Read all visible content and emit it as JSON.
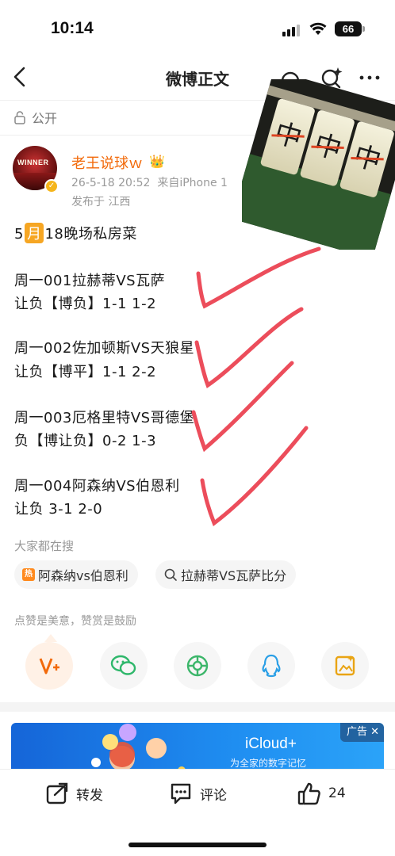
{
  "status": {
    "time": "10:14",
    "battery": "66"
  },
  "nav": {
    "title": "微博正文"
  },
  "post_meta": {
    "visibility": "公开",
    "username": "老王说球ｗ",
    "crown": "👑",
    "timestamp": "26-5-18 20:52",
    "source": "来自iPhone 1",
    "location": "发布于 江西"
  },
  "avatar_text": "WINNER",
  "post": {
    "title_pre": "5",
    "title_month": "月",
    "title_post": "18晚场私房菜",
    "matches": [
      {
        "line1": "周一001拉赫蒂VS瓦萨",
        "line2": "让负【博负】1-1 1-2"
      },
      {
        "line1": "周一002佐加顿斯VS天狼星",
        "line2": "让负【博平】1-1 2-2"
      },
      {
        "line1": "周一003厄格里特VS哥德堡",
        "line2": "负【博让负】0-2 1-3"
      },
      {
        "line1": "周一004阿森纳VS伯恩利",
        "line2": "让负 3-1 2-0"
      }
    ]
  },
  "search": {
    "label": "大家都在搜",
    "chips": [
      "阿森纳vs伯恩利",
      "拉赫蒂VS瓦萨比分"
    ]
  },
  "like_hint": "点赞是美意，赞赏是鼓励",
  "ad": {
    "title": "iCloud+",
    "subtitle": "为全家的数字记忆",
    "tag": "广告"
  },
  "actions": {
    "repost": "转发",
    "comment": "评论",
    "likes": "24"
  },
  "colors": {
    "accent": "#f26a0b",
    "check": "#ec4d5b",
    "ad_bg": "#1f8ef1"
  }
}
